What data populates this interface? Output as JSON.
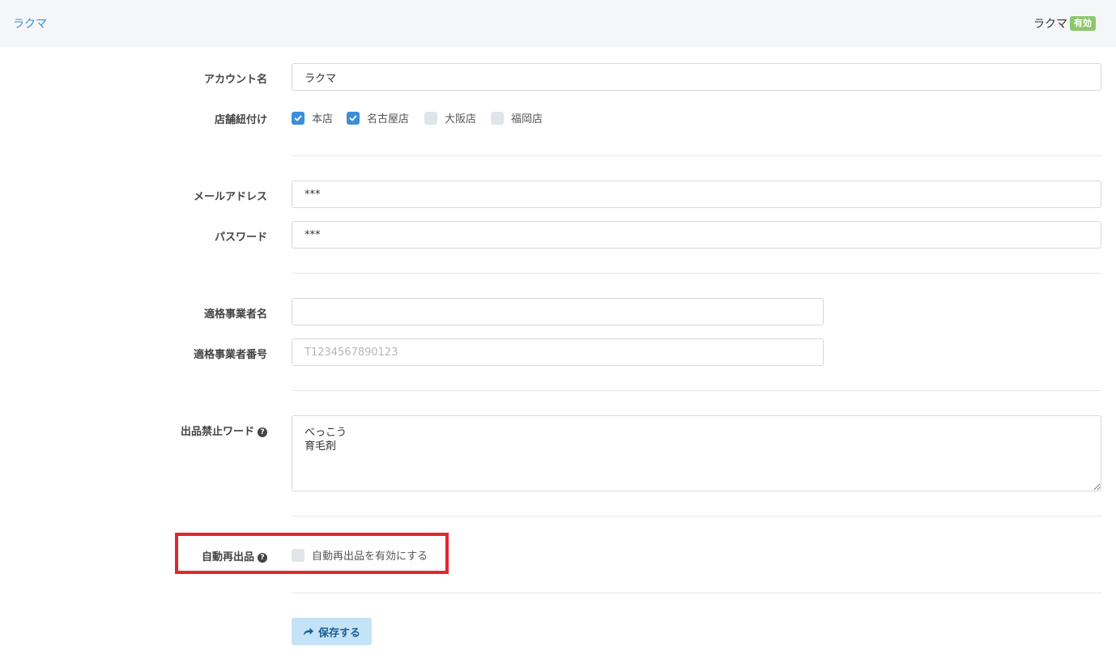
{
  "header": {
    "brand": "ラクマ",
    "account": "ラクマ",
    "status": "有効",
    "status_color": "#8dc76b"
  },
  "form": {
    "account_name": {
      "label": "アカウント名",
      "value": "ラクマ"
    },
    "stores": {
      "label": "店舗紐付け",
      "options": [
        {
          "label": "本店",
          "checked": true
        },
        {
          "label": "名古屋店",
          "checked": true
        },
        {
          "label": "大阪店",
          "checked": false
        },
        {
          "label": "福岡店",
          "checked": false
        }
      ]
    },
    "email": {
      "label": "メールアドレス",
      "value": "***"
    },
    "password": {
      "label": "パスワード",
      "value": "***"
    },
    "qualified_name": {
      "label": "適格事業者名",
      "value": ""
    },
    "qualified_number": {
      "label": "適格事業者番号",
      "value": "",
      "placeholder": "T1234567890123"
    },
    "banned_words": {
      "label": "出品禁止ワード",
      "value": "べっこう\n育毛剤"
    },
    "auto_relist": {
      "label": "自動再出品",
      "checkbox_label": "自動再出品を有効にする",
      "checked": false
    },
    "save_label": "保存する"
  },
  "colors": {
    "accent": "#3b8fd6",
    "highlight": "#e3262d",
    "save_bg": "#c5e3f7"
  }
}
